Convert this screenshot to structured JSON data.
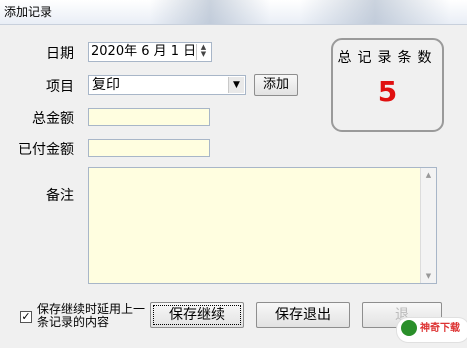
{
  "window": {
    "title": "添加记录"
  },
  "form": {
    "date_label": "日期",
    "date_value": "2020年 6 月 1 日",
    "project_label": "项目",
    "project_value": "复印",
    "add_button": "添加",
    "total_amount_label": "总金额",
    "total_amount_value": "",
    "paid_amount_label": "已付金额",
    "paid_amount_value": "",
    "remark_label": "备注",
    "remark_value": ""
  },
  "counter": {
    "title": "总记录条数",
    "value": "5"
  },
  "footer": {
    "checkbox_label": "保存继续时延用上一条记录的内容",
    "checkbox_checked": true,
    "save_continue": "保存继续",
    "save_exit": "保存退出",
    "partial_button": "退"
  },
  "watermark": {
    "text": "神奇下载"
  },
  "icons": {
    "combo_arrow": "chevron-down-icon",
    "spin": "spin-updown-icon",
    "check": "checkmark-icon"
  },
  "colors": {
    "field_bg": "#fffee0",
    "counter_value": "#e01010"
  }
}
